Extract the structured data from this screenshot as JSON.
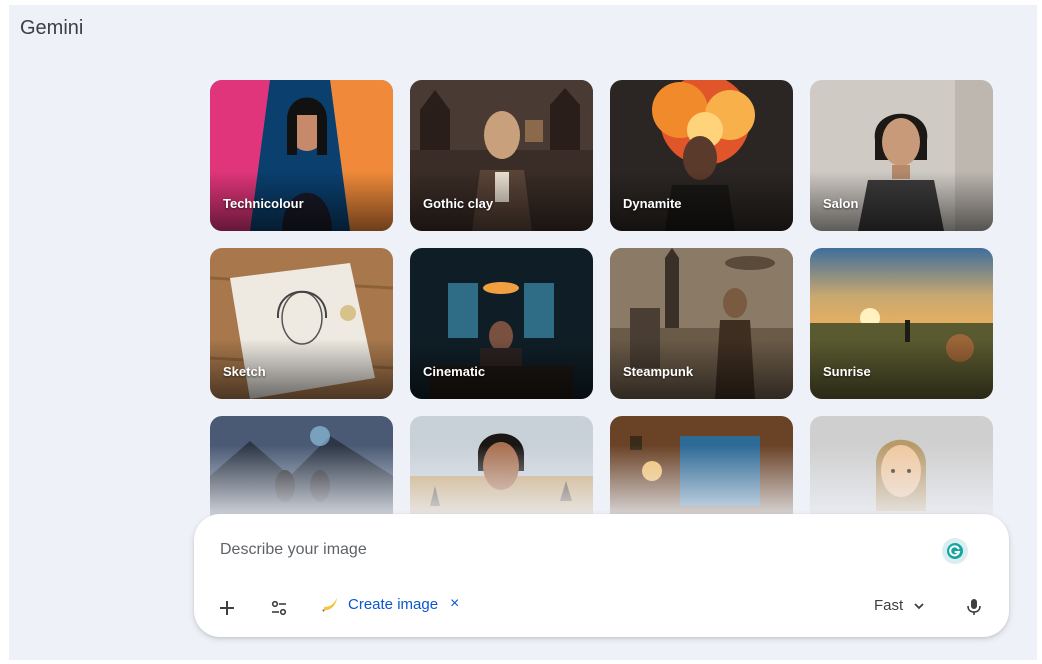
{
  "app": {
    "title": "Gemini"
  },
  "styles": [
    {
      "label": "Technicolour"
    },
    {
      "label": "Gothic clay"
    },
    {
      "label": "Dynamite"
    },
    {
      "label": "Salon"
    },
    {
      "label": "Sketch"
    },
    {
      "label": "Cinematic"
    },
    {
      "label": "Steampunk"
    },
    {
      "label": "Sunrise"
    },
    {
      "label": ""
    },
    {
      "label": ""
    },
    {
      "label": ""
    },
    {
      "label": ""
    }
  ],
  "composer": {
    "placeholder": "Describe your image",
    "tool_chip": {
      "label": "Create image",
      "close": "×"
    },
    "mode": {
      "label": "Fast"
    }
  },
  "icons": {
    "add": "plus-icon",
    "tools": "tune-icon",
    "chip": "banana-icon",
    "mode_chevron": "chevron-down-icon",
    "mic": "mic-icon",
    "badge": "grammarly-icon"
  },
  "colors": {
    "accent": "#0b57d0",
    "background": "#eef1f7"
  }
}
